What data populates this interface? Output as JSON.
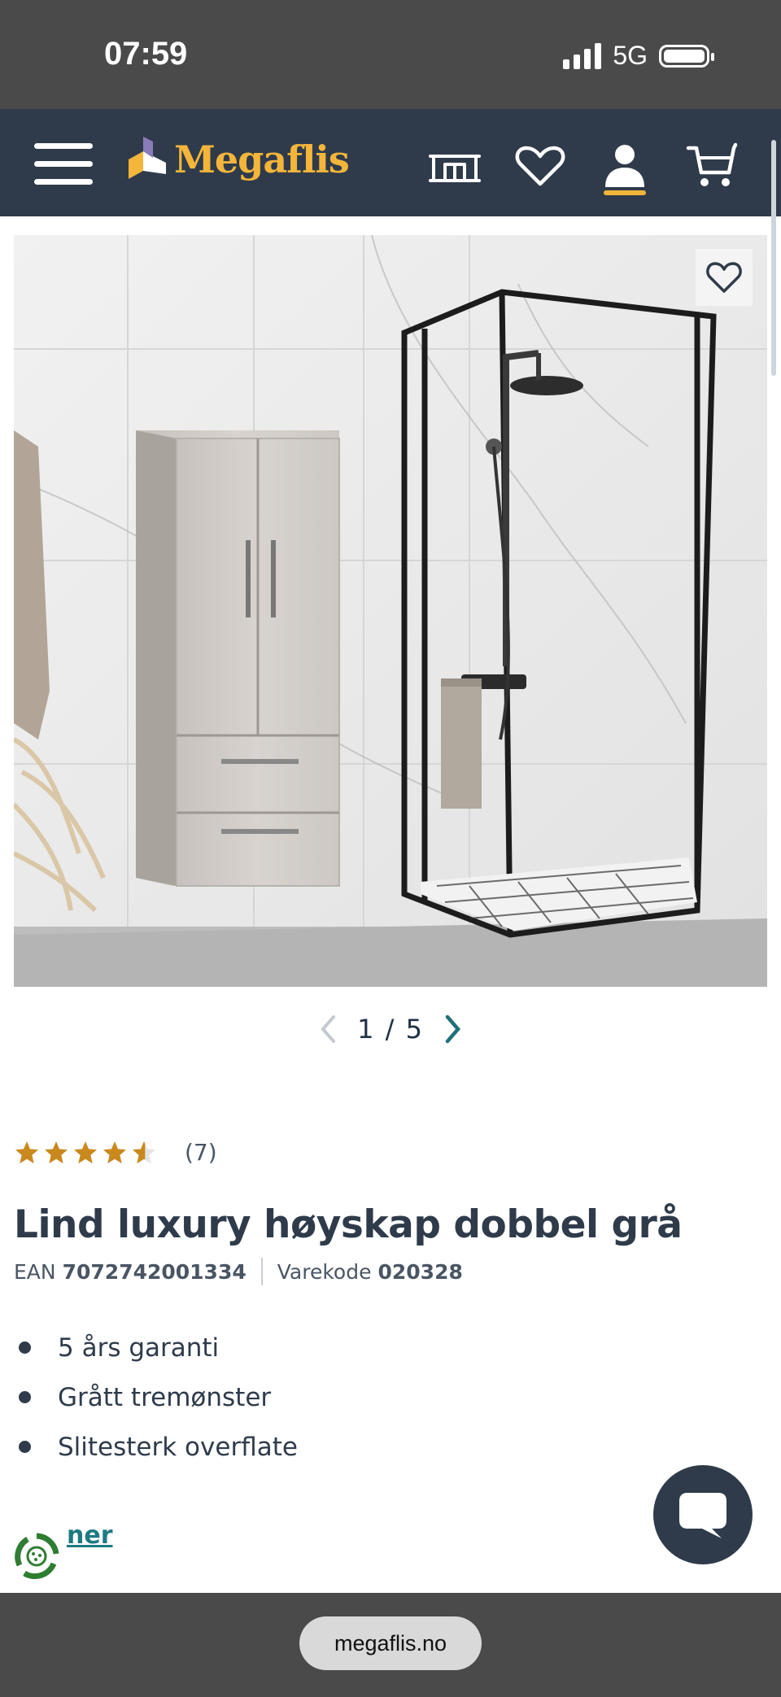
{
  "status_bar": {
    "time": "07:59",
    "network": "5G"
  },
  "header": {
    "brand": "Megaflis"
  },
  "gallery": {
    "current": "1",
    "separator": "/",
    "total": "5"
  },
  "product": {
    "rating": 4.5,
    "review_count": "(7)",
    "title": "Lind luxury høyskap dobbel grå",
    "ean_label": "EAN",
    "ean": "7072742001334",
    "code_label": "Varekode",
    "code": "020328",
    "features": [
      "5 års garanti",
      "Grått tremønster",
      "Slitesterk overflate"
    ],
    "details_link": "ner"
  },
  "browser": {
    "url": "megaflis.no"
  },
  "colors": {
    "header_bg": "#2f3b4b",
    "brand_yellow": "#f3b53a",
    "star": "#c9891e",
    "link": "#1f7a82"
  }
}
